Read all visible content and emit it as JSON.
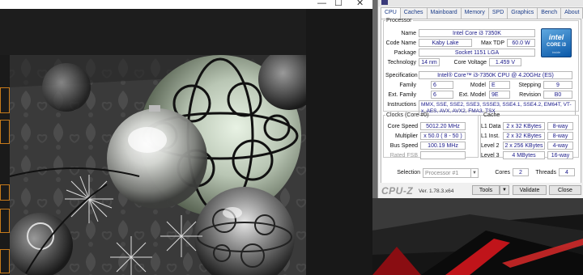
{
  "viewer": {
    "titlebar_controls": {
      "minimize": "—",
      "maximize": "☐",
      "close": "✕"
    }
  },
  "cpuz": {
    "tabs": [
      "CPU",
      "Caches",
      "Mainboard",
      "Memory",
      "SPD",
      "Graphics",
      "Bench",
      "About"
    ],
    "active_tab": "CPU",
    "processor": {
      "legend": "Processor",
      "name_label": "Name",
      "name": "Intel Core i3 7350K",
      "codename_label": "Code Name",
      "codename": "Kaby Lake",
      "maxtdp_label": "Max TDP",
      "maxtdp": "60.0 W",
      "package_label": "Package",
      "package": "Socket 1151 LGA",
      "technology_label": "Technology",
      "technology": "14 nm",
      "corevoltage_label": "Core Voltage",
      "corevoltage": "1.459 V",
      "specification_label": "Specification",
      "specification": "Intel® Core™ i3-7350K CPU @ 4.20GHz (ES)",
      "family_label": "Family",
      "family": "6",
      "model_label": "Model",
      "model": "E",
      "stepping_label": "Stepping",
      "stepping": "9",
      "extfamily_label": "Ext. Family",
      "extfamily": "6",
      "extmodel_label": "Ext. Model",
      "extmodel": "9E",
      "revision_label": "Revision",
      "revision": "B0",
      "instructions_label": "Instructions",
      "instructions": "MMX, SSE, SSE2, SSE3, SSSE3, SSE4.1, SSE4.2, EM64T, VT-x, AES, AVX, AVX2, FMA3, TSX",
      "logo_word": "intel",
      "logo_core": "CORE i3",
      "logo_inside": "inside"
    },
    "clocks": {
      "legend": "Clocks (Core #0)",
      "corespeed_label": "Core Speed",
      "corespeed": "5012.20 MHz",
      "multiplier_label": "Multiplier",
      "multiplier": "x 50.0 ( 8 - 50 )",
      "busspeed_label": "Bus Speed",
      "busspeed": "100.19 MHz",
      "ratedfsb_label": "Rated FSB",
      "ratedfsb": ""
    },
    "cache": {
      "legend": "Cache",
      "rows": [
        {
          "label": "L1 Data",
          "size": "2 x 32 KBytes",
          "way": "8-way"
        },
        {
          "label": "L1 Inst.",
          "size": "2 x 32 KBytes",
          "way": "8-way"
        },
        {
          "label": "Level 2",
          "size": "2 x 256 KBytes",
          "way": "4-way"
        },
        {
          "label": "Level 3",
          "size": "4 MBytes",
          "way": "16-way"
        }
      ]
    },
    "selection_label": "Selection",
    "selection": "Processor #1",
    "cores_label": "Cores",
    "cores": "2",
    "threads_label": "Threads",
    "threads": "4",
    "brand": "CPU-Z",
    "version": "Ver. 1.78.3.x64",
    "tools": "Tools",
    "validate": "Validate",
    "close": "Close"
  }
}
